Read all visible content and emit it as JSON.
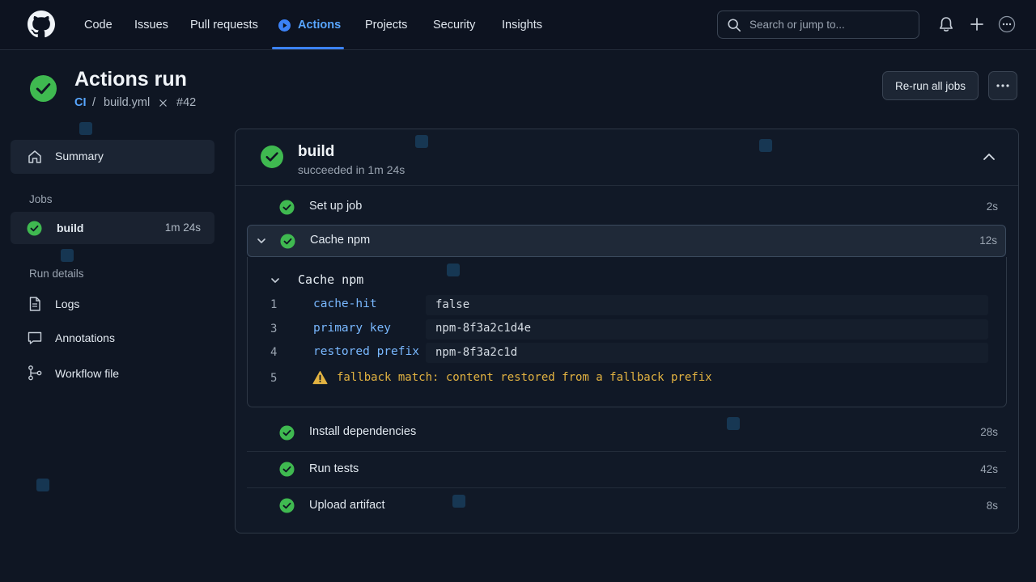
{
  "nav": {
    "items": [
      "Code",
      "Issues",
      "Pull requests",
      "Actions",
      "Projects",
      "Security",
      "Insights"
    ],
    "active": "Actions",
    "search_placeholder": "Search or jump to..."
  },
  "header": {
    "title": "Actions run",
    "workflow": "CI",
    "separator": "/",
    "file": "build.yml",
    "run_number": "#42",
    "rerun_label": "Re-run all jobs"
  },
  "sidebar": {
    "summary": "Summary",
    "jobs_heading": "Jobs",
    "job": {
      "name": "build",
      "duration": "1m 24s"
    },
    "run_details_heading": "Run details",
    "details": [
      "Logs",
      "Annotations",
      "Workflow file"
    ]
  },
  "job": {
    "name": "build",
    "status_text": "succeeded in 1m 24s",
    "steps": [
      {
        "name": "Set up job",
        "duration": "2s"
      },
      {
        "name": "Cache npm",
        "duration": "12s"
      },
      {
        "name": "Install dependencies",
        "duration": "28s"
      },
      {
        "name": "Run tests",
        "duration": "42s"
      },
      {
        "name": "Upload artifact",
        "duration": "8s"
      }
    ],
    "log": {
      "group_title": "Cache npm",
      "lines": [
        {
          "num": "1",
          "key": "cache-hit",
          "value": "false"
        },
        {
          "num": "3",
          "key": "primary key",
          "value": "npm-8f3a2c1d4e"
        },
        {
          "num": "4",
          "key": "restored prefix",
          "value": "npm-8f3a2c1d"
        }
      ],
      "warning": {
        "num": "5",
        "text": "fallback match: content restored from a fallback prefix"
      }
    }
  },
  "colors": {
    "background": "#0f1623",
    "accent": "#58a6ff",
    "success": "#3fb950",
    "warning": "#e3b341"
  }
}
